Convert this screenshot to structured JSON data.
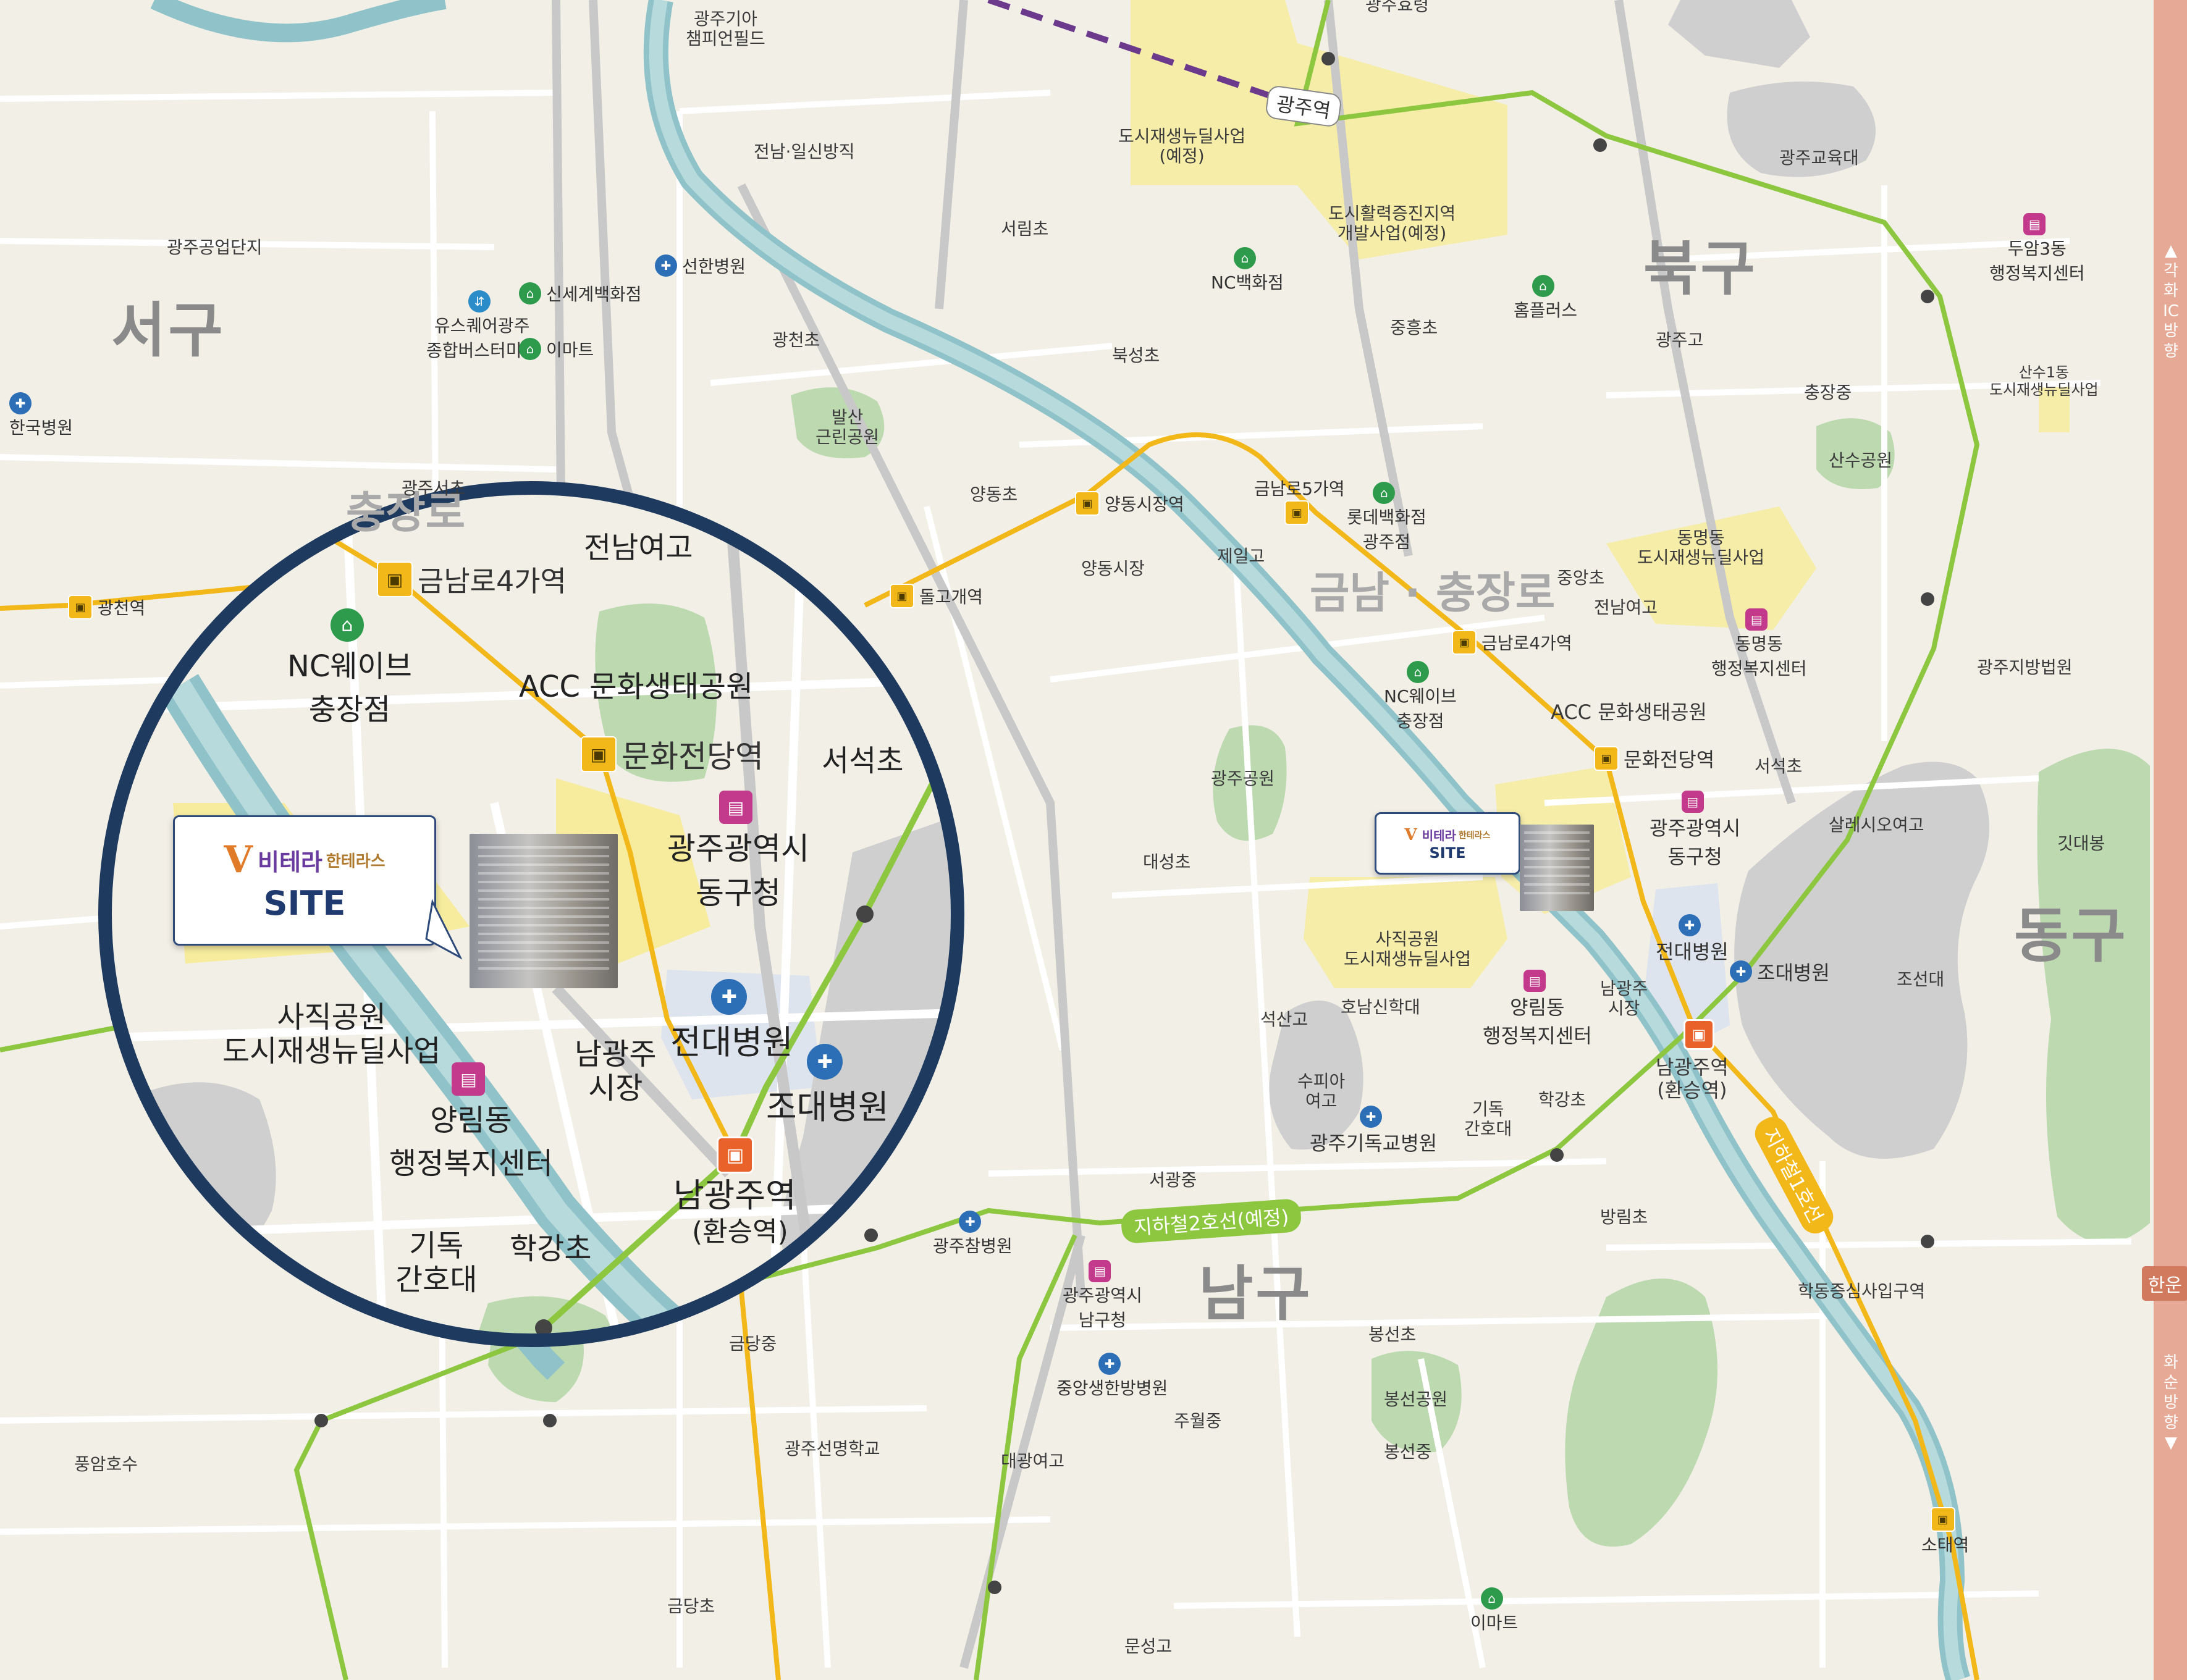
{
  "districts": {
    "seogu": "서구",
    "bukgu": "북구",
    "donggu": "동구",
    "namgu": "남구",
    "area_partial": "충장로",
    "area_main": "금남 · 충장로"
  },
  "side_road": {
    "top": "▲ 각화 IC 방향",
    "bottom": "화순방향 ▼",
    "tag": "한운"
  },
  "lines": {
    "line2_label": "지하철2호선(예정)",
    "line1_label": "지하철1호선",
    "gwangju_station": "광주역"
  },
  "site": {
    "logo_main": "비테라",
    "logo_sub": "한테라스",
    "label": "SITE"
  },
  "zoom": {
    "stations": {
      "geumnamro4": "금남로4가역",
      "munhwa": "문화전당역",
      "namgwangju": "남광주역",
      "namgwangju_sub": "(환승역)"
    },
    "labels": {
      "jeonnam_girls": "전남여고",
      "acc": "ACC 문화생태공원",
      "seoseok": "서석초",
      "donggu_office": "광주광역시\n동구청",
      "jeondae": "전대병원",
      "josun": "조대병원",
      "nc_wave": "NC웨이브\n충장점",
      "sajik": "사직공원\n도시재생뉴딜사업",
      "yangrim": "양림동\n행정복지센터",
      "namgwangju_market": "남광주\n시장",
      "gidok": "기독\n간호대",
      "hakgang": "학강초",
      "gwangju_seo": "광주서초"
    }
  },
  "labels": {
    "kia": "광주기아\n챔피언필드",
    "jeonnam_spinning": "전남·일신방직",
    "gwangju_industrial": "광주공업단지",
    "us_square": "유스퀘어광주\n종합버스터미널",
    "shinsegae": "신세계백화점",
    "emart_w": "이마트",
    "seonhan": "선한병원",
    "hanguk": "한국병원",
    "gwangcheon": "광천초",
    "balsan": "발산\n근린공원",
    "seorim": "서림초",
    "nc_dept": "NC백화점",
    "bukseong": "북성초",
    "urban_regen_top": "도시재생뉴딜사업\n(예정)",
    "urban_vital": "도시활력증진지역\n개발사업(예정)",
    "jungheung": "중흥초",
    "homeplus": "홈플러스",
    "gwangju_edu": "광주교육대",
    "dooam": "두암3동\n행정복지센터",
    "gwangju_high": "광주고",
    "chungjang_mid": "충장중",
    "sansu": "산수1동\n도시재생뉴딜사업",
    "sansu_park": "산수공원",
    "yangdong_elem": "양동초",
    "yangdong_market_sta": "양동시장역",
    "yangdong_market": "양동시장",
    "geumnamro5": "금남로5가역",
    "lotte": "롯데백화점\n광주점",
    "jeil": "제일고",
    "dolgogae": "돌고개역",
    "gwangchon": "광천역",
    "dongmyeong": "동명동\n도시재생뉴딜사업",
    "dongmyeong_office": "동명동\n행정복지센터",
    "jungang": "중앙초",
    "jeonnam_girls": "전남여고",
    "geumnamro4": "금남로4가역",
    "nc_wave": "NC웨이브\n충장점",
    "acc": "ACC 문화생태공원",
    "munhwa": "문화전당역",
    "seoseok": "서석초",
    "gwangju_court": "광주지방법원",
    "salesio": "살레시오여고",
    "gitdae": "깃대봉",
    "gwangju_park": "광주공원",
    "daeseong": "대성초",
    "donggu_office": "광주광역시\n동구청",
    "jeondae": "전대병원",
    "josun_hosp": "조대병원",
    "josun_univ": "조선대",
    "sajik": "사직공원\n도시재생뉴딜사업",
    "seoksan": "석산고",
    "honam_theo": "호남신학대",
    "yangrim": "양림동\n행정복지센터",
    "namgwangju_market": "남광주\n시장",
    "namgwangju": "남광주역\n(환승역)",
    "supia": "수피아\n여고",
    "gidok": "기독\n간호대",
    "hakgang": "학강초",
    "gidok_hosp": "광주기독교병원",
    "seoseok_mid": "서광중",
    "bangrim": "방림초",
    "hakdong": "학동증심사입구역",
    "chamjoeun": "광주참병원",
    "namgu_office": "광주광역시\n남구청",
    "bongseon_elem": "봉선초",
    "bongseon_park": "봉선공원",
    "bongseon_mid": "봉선중",
    "geumdang_mid": "금당중",
    "jungang_hosp": "중앙생한방병원",
    "juwol": "주월중",
    "pungam": "풍암호수",
    "seomyeong": "광주선명학교",
    "daegwang": "대광여고",
    "geumdang_elem": "금당초",
    "munseong": "문성고",
    "emart_s": "이마트",
    "sotae": "소태역",
    "gwangju_hyo": "광주효령"
  }
}
